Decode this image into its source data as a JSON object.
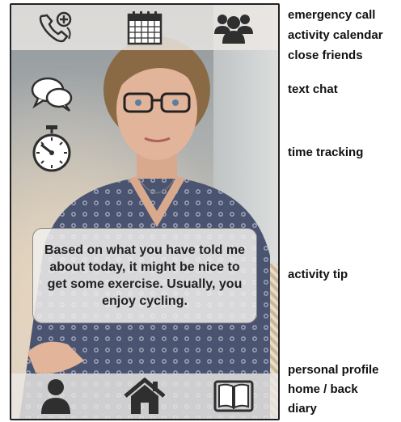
{
  "tip": {
    "text": "Based on what you have told me about today, it might be nice to get some exercise. Usually, you enjoy cycling."
  },
  "icons": {
    "top": [
      "phone-plus-icon",
      "calendar-icon",
      "group-icon"
    ],
    "side": [
      "chat-bubbles-icon",
      "stopwatch-icon"
    ],
    "bottom": [
      "person-icon",
      "home-icon",
      "book-icon"
    ]
  },
  "annotations": {
    "emergency_call": "emergency call",
    "activity_calendar": "activity calendar",
    "close_friends": "close friends",
    "text_chat": "text chat",
    "time_tracking": "time tracking",
    "activity_tip": "activity tip",
    "personal_profile": "personal profile",
    "home_back": "home / back",
    "diary": "diary"
  },
  "colors": {
    "icon": "#2f2f2f",
    "bar": "#ebe8e4",
    "bubble": "#f0eeec"
  }
}
